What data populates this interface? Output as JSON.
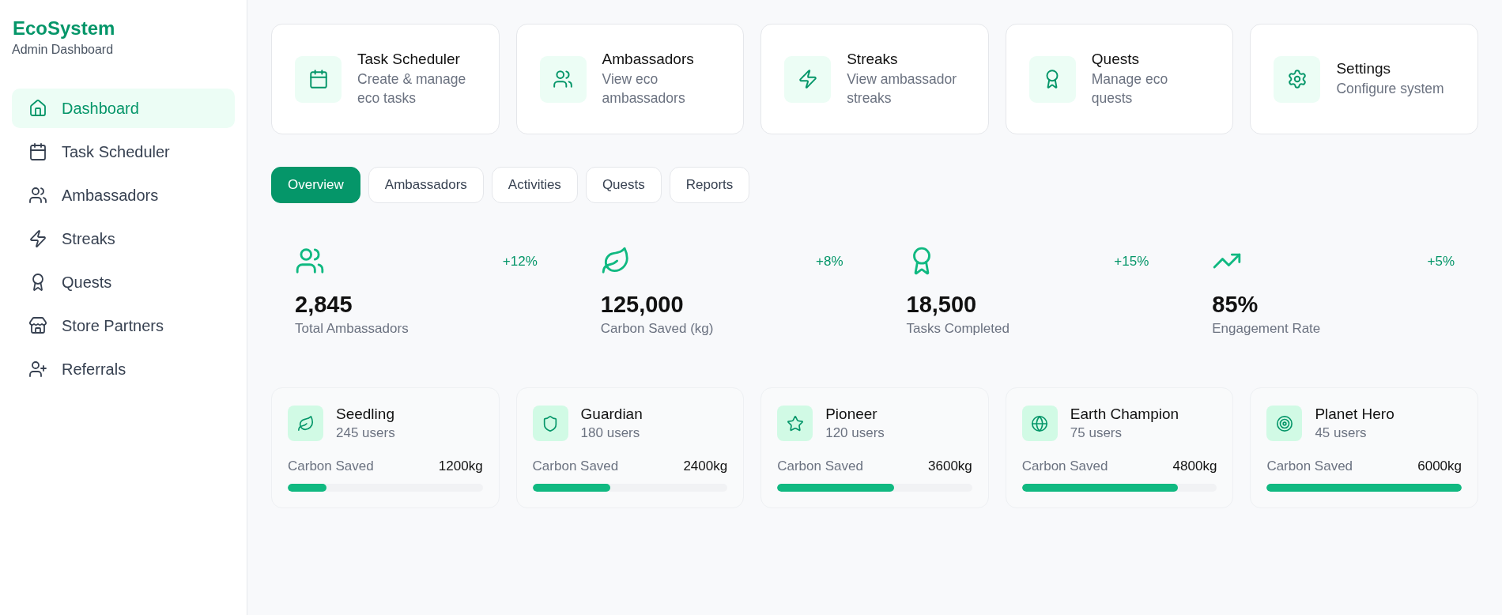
{
  "sidebar": {
    "brand": "EcoSystem",
    "subtitle": "Admin Dashboard",
    "items": [
      {
        "label": "Dashboard",
        "selected": true
      },
      {
        "label": "Task Scheduler",
        "selected": false
      },
      {
        "label": "Ambassadors",
        "selected": false
      },
      {
        "label": "Streaks",
        "selected": false
      },
      {
        "label": "Quests",
        "selected": false
      },
      {
        "label": "Store Partners",
        "selected": false
      },
      {
        "label": "Referrals",
        "selected": false
      }
    ]
  },
  "quick_links": [
    {
      "title": "Task Scheduler",
      "description": "Create & manage eco tasks"
    },
    {
      "title": "Ambassadors",
      "description": "View eco ambassadors"
    },
    {
      "title": "Streaks",
      "description": "View ambassador streaks"
    },
    {
      "title": "Quests",
      "description": "Manage eco quests"
    },
    {
      "title": "Settings",
      "description": "Configure system"
    }
  ],
  "tabs": [
    {
      "label": "Overview",
      "selected": true
    },
    {
      "label": "Ambassadors",
      "selected": false
    },
    {
      "label": "Activities",
      "selected": false
    },
    {
      "label": "Quests",
      "selected": false
    },
    {
      "label": "Reports",
      "selected": false
    }
  ],
  "stats": [
    {
      "value": "2,845",
      "label": "Total Ambassadors",
      "change": "+12%"
    },
    {
      "value": "125,000",
      "label": "Carbon Saved (kg)",
      "change": "+8%"
    },
    {
      "value": "18,500",
      "label": "Tasks Completed",
      "change": "+15%"
    },
    {
      "value": "85%",
      "label": "Engagement Rate",
      "change": "+5%"
    }
  ],
  "levels": [
    {
      "name": "Seedling",
      "users": "245 users",
      "metric": "Carbon Saved",
      "amount": "1200kg",
      "level": 0.2
    },
    {
      "name": "Guardian",
      "users": "180 users",
      "metric": "Carbon Saved",
      "amount": "2400kg",
      "level": 0.4
    },
    {
      "name": "Pioneer",
      "users": "120 users",
      "metric": "Carbon Saved",
      "amount": "3600kg",
      "level": 0.6
    },
    {
      "name": "Earth Champion",
      "users": "75 users",
      "metric": "Carbon Saved",
      "amount": "4800kg",
      "level": 0.8
    },
    {
      "name": "Planet Hero",
      "users": "45 users",
      "metric": "Carbon Saved",
      "amount": "6000kg",
      "level": 1.0
    }
  ]
}
